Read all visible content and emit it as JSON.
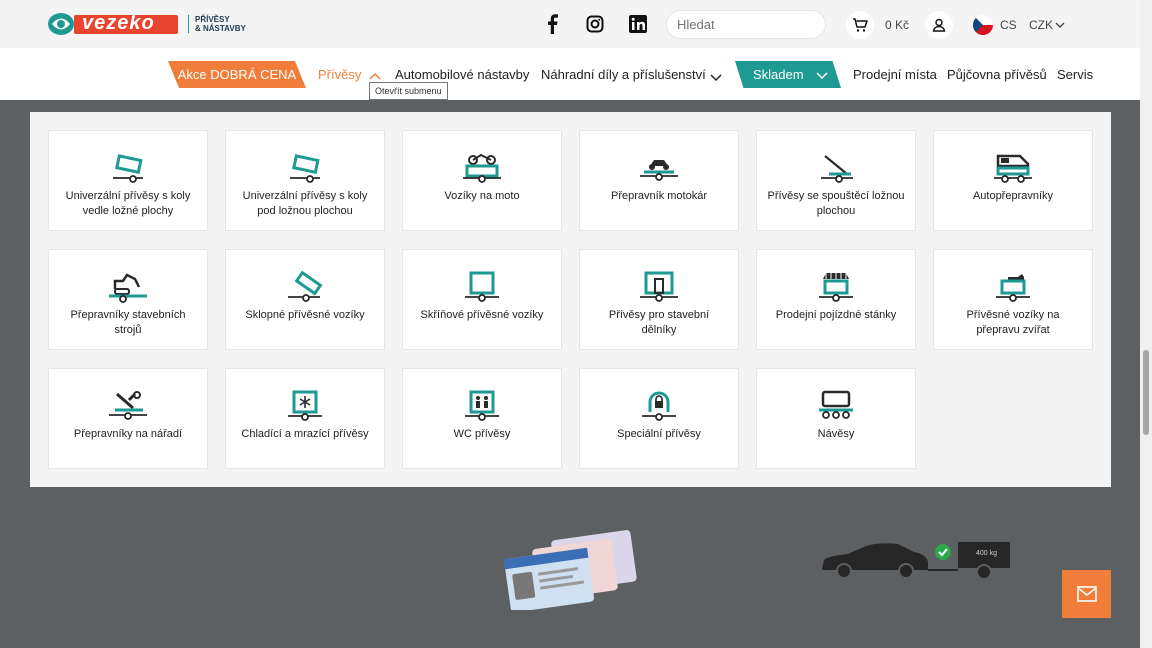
{
  "header": {
    "logo_text": "vezeko",
    "logo_sub1": "PŘÍVĚSY",
    "logo_sub2": "& NÁSTAVBY",
    "search_placeholder": "Hledat",
    "cart_total": "0 Kč",
    "language": "CS",
    "currency": "CZK"
  },
  "nav": {
    "promo": "Akce DOBRÁ CENA",
    "trailers": "Přívěsy",
    "superstructures": "Automobilové nástavby",
    "parts": "Náhradní díly a příslušenství",
    "stock": "Skladem",
    "stores": "Prodejní místa",
    "rental": "Půjčovna přívěsů",
    "service": "Servis",
    "tooltip": "Otevřít submenu"
  },
  "submenu": [
    {
      "label": "Univerzální přívěsy s koly vedle ložné plochy",
      "icon": "tilt-trailer-icon"
    },
    {
      "label": "Univerzální přívěsy s koly pod ložnou plochou",
      "icon": "tilt-trailer-icon"
    },
    {
      "label": "Vozíky na moto",
      "icon": "motorbike-trailer-icon"
    },
    {
      "label": "Přepravník motokár",
      "icon": "kart-trailer-icon"
    },
    {
      "label": "Přívěsy se spouštěcí ložnou plochou",
      "icon": "lowering-trailer-icon"
    },
    {
      "label": "Autopřepravníky",
      "icon": "car-transporter-icon"
    },
    {
      "label": "Přepravníky stavebních strojů",
      "icon": "excavator-trailer-icon"
    },
    {
      "label": "Sklopné přívěsné vozíky",
      "icon": "tipper-trailer-icon"
    },
    {
      "label": "Skříňové přívěsné vozíky",
      "icon": "box-trailer-icon"
    },
    {
      "label": "Přívěsy pro stavební dělníky",
      "icon": "worker-trailer-icon"
    },
    {
      "label": "Prodejní pojízdné stánky",
      "icon": "stall-trailer-icon"
    },
    {
      "label": "Přívěsné vozíky na přepravu zvířat",
      "icon": "animal-trailer-icon"
    },
    {
      "label": "Přepravníky na nářadí",
      "icon": "tool-trailer-icon"
    },
    {
      "label": "Chladící a mrazící přívěsy",
      "icon": "freezer-trailer-icon"
    },
    {
      "label": "WC přívěsy",
      "icon": "wc-trailer-icon"
    },
    {
      "label": "Speciální přívěsy",
      "icon": "special-trailer-icon"
    },
    {
      "label": "Návěsy",
      "icon": "semi-trailer-icon"
    }
  ],
  "bottom": {
    "weight_label": "400 kg"
  },
  "colors": {
    "teal": "#1f9a93",
    "orange": "#f07e3a",
    "dark": "#2a2a2a"
  }
}
